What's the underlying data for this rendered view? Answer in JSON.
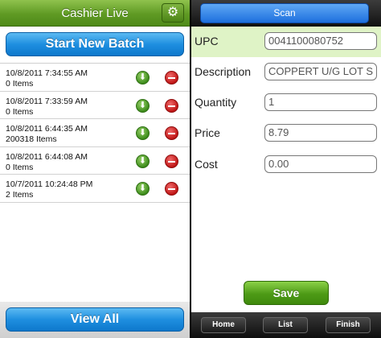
{
  "left": {
    "title": "Cashier Live",
    "gear_icon": "gear-icon",
    "start_button": "Start New Batch",
    "view_all_button": "View All",
    "batches": [
      {
        "date": "10/8/2011 7:34:55 AM",
        "items": "0 Items"
      },
      {
        "date": "10/8/2011 7:33:59 AM",
        "items": "0 Items"
      },
      {
        "date": "10/8/2011 6:44:35 AM",
        "items": "200318 Items"
      },
      {
        "date": "10/8/2011 6:44:08 AM",
        "items": "0 Items"
      },
      {
        "date": "10/7/2011 10:24:48 PM",
        "items": "2 Items"
      }
    ]
  },
  "right": {
    "scan_button": "Scan",
    "fields": {
      "upc": {
        "label": "UPC",
        "value": "0041100080752"
      },
      "description": {
        "label": "Description",
        "value": "COPPERT U/G LOT S"
      },
      "quantity": {
        "label": "Quantity",
        "value": "1"
      },
      "price": {
        "label": "Price",
        "value": "8.79"
      },
      "cost": {
        "label": "Cost",
        "value": "0.00"
      }
    },
    "save_button": "Save",
    "tabs": {
      "home": "Home",
      "list": "List",
      "finish": "Finish"
    }
  },
  "colors": {
    "header_green": "#5f9a24",
    "button_blue": "#1f8fe0",
    "upc_highlight": "#dff3c6",
    "save_green": "#4d9a16"
  }
}
